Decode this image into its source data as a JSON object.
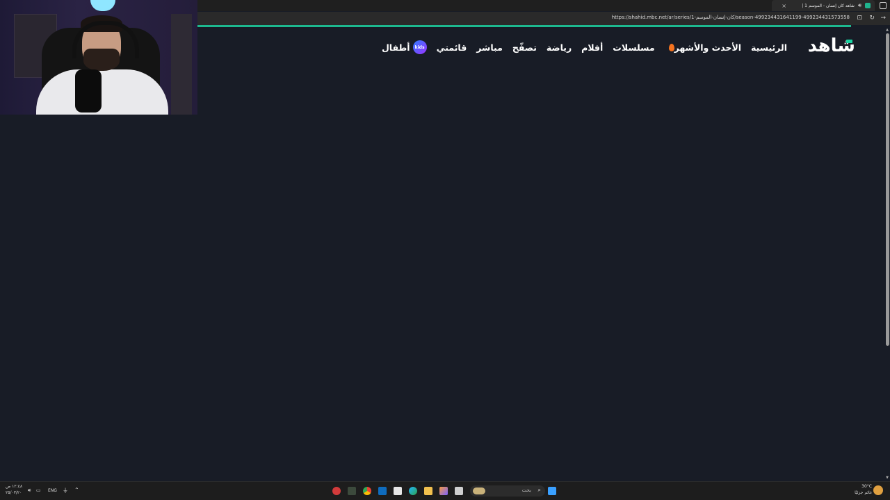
{
  "browser": {
    "tab": {
      "title": "شاهد كان إنسان - الموسم 1 |"
    },
    "new_tab_symbol": "+",
    "close_symbol": "×",
    "url": "https://shahid.mbc.net/ar/series/كان-إنسان-الموسم-1/season-499234431641199-499234431573558"
  },
  "site": {
    "logo_text": "شاهد",
    "accent_color": "#1db98f",
    "nav": {
      "home": "الرئيسية",
      "trending": "الأحدث والأشهر",
      "series": "مسلسلات",
      "movies": "أفلام",
      "sports": "رياضة",
      "browse": "تصفّح",
      "live": "مباشر",
      "mylist": "قائمتي",
      "kids_badge": "kids",
      "kids": "أطفال"
    }
  },
  "taskbar": {
    "search_placeholder": "بحث",
    "clock_time": "١٢:٤٨ ص",
    "clock_date": "٢٥/٠٣/٢٠",
    "language": "ENG",
    "weather_temp": "30°C",
    "weather_desc": "غائم جزئيًا"
  }
}
